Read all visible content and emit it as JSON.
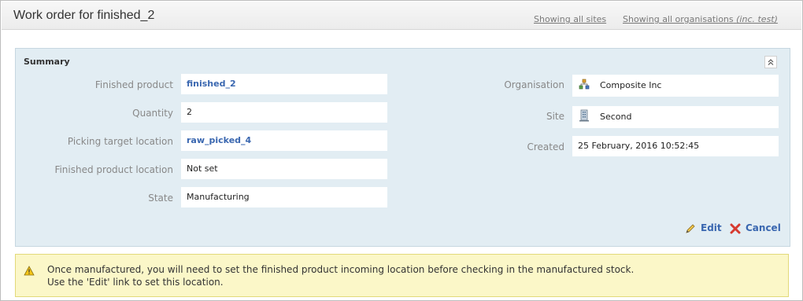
{
  "header": {
    "title": "Work order for finished_2",
    "showing_sites": "Showing all sites",
    "showing_orgs": "Showing all organisations",
    "showing_orgs_suffix": "(inc. test)"
  },
  "summary": {
    "title": "Summary",
    "collapse_icon": "double-chevron-up-icon",
    "left": [
      {
        "label": "Finished product",
        "value": "finished_2",
        "link": true
      },
      {
        "label": "Quantity",
        "value": "2",
        "link": false
      },
      {
        "label": "Picking target location",
        "value": "raw_picked_4",
        "link": true
      },
      {
        "label": "Finished product location",
        "value": "Not set",
        "link": false
      },
      {
        "label": "State",
        "value": "Manufacturing",
        "link": false
      }
    ],
    "right": [
      {
        "label": "Organisation",
        "value": "Composite Inc",
        "icon": "organisation-icon"
      },
      {
        "label": "Site",
        "value": "Second",
        "icon": "building-icon"
      },
      {
        "label": "Created",
        "value": "25 February, 2016 10:52:45"
      }
    ],
    "actions": {
      "edit_label": "Edit",
      "cancel_label": "Cancel",
      "edit_icon": "pencil-icon",
      "cancel_icon": "red-x-icon"
    }
  },
  "warning": {
    "icon": "warning-triangle-icon",
    "line1": "Once manufactured, you will need to set the finished product incoming location before checking in the manufactured stock.",
    "line2": "Use the 'Edit' link to set this location."
  },
  "colors": {
    "link": "#3a67b0",
    "panel_bg": "#e2edf3",
    "warning_bg": "#fbf7c8",
    "cancel_red": "#d63a2f"
  }
}
